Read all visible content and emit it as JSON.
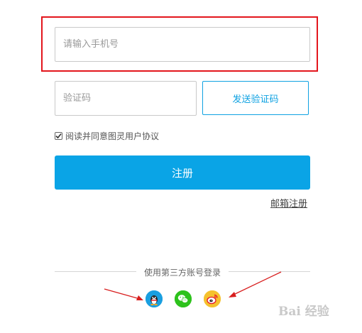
{
  "form": {
    "phone_placeholder": "请输入手机号",
    "code_placeholder": "验证码",
    "send_code_label": "发送验证码",
    "agreement_label": "阅读并同意图灵用户协议",
    "agreement_checked": true,
    "register_label": "注册",
    "email_register_label": "邮箱注册"
  },
  "social": {
    "divider_label": "使用第三方账号登录",
    "providers": [
      {
        "icon": "qq-icon"
      },
      {
        "icon": "wechat-icon"
      },
      {
        "icon": "weibo-icon"
      }
    ]
  },
  "annotations": {
    "highlight_color": "#e3161d",
    "arrow_color": "#d81e1e"
  },
  "colors": {
    "accent": "#0aa4e6",
    "link_blue": "#0fa2e2"
  },
  "watermark": "Bai 经验"
}
